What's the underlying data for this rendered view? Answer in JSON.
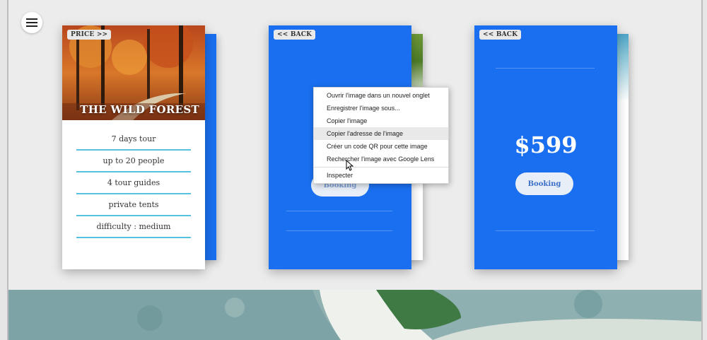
{
  "nav": {
    "menu_icon": "hamburger-menu-icon"
  },
  "cards": [
    {
      "tag_label": "PRICE >>",
      "title": "THE WILD FOREST",
      "features": [
        "7 days tour",
        "up to 20 people",
        "4 tour guides",
        "private tents",
        "difficulty : medium"
      ]
    },
    {
      "tag_label": "<< BACK",
      "book_label": "Booking"
    },
    {
      "tag_label": "<< BACK",
      "price": "$599",
      "book_label": "Booking"
    }
  ],
  "context_menu": {
    "items": [
      "Ouvrir l'image dans un nouvel onglet",
      "Enregistrer l'image sous...",
      "Copier l'image",
      "Copier l'adresse de l'image",
      "Créer un code QR pour cette image",
      "Rechercher l'image avec Google Lens",
      "Inspecter"
    ],
    "highlighted_index": 3
  },
  "colors": {
    "card_blue": "#1a6ff0",
    "feature_underline": "#57c2e0",
    "page_bg": "#ececec"
  }
}
